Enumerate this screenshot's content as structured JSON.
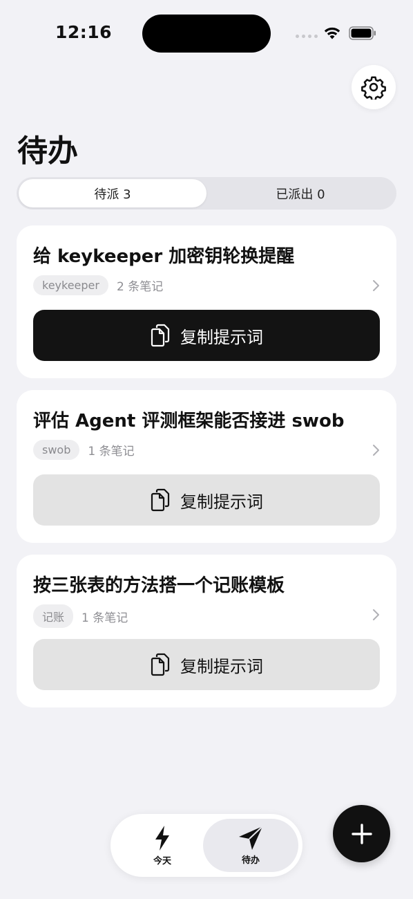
{
  "status_bar": {
    "time": "12:16"
  },
  "header": {
    "title": "待办"
  },
  "segments": [
    {
      "label": "待派 3",
      "active": true
    },
    {
      "label": "已派出 0",
      "active": false
    }
  ],
  "tasks": [
    {
      "title": "给 keykeeper 加密钥轮换提醒",
      "tag": "keykeeper",
      "notes": "2 条笔记",
      "button": "复制提示词",
      "button_style": "dark"
    },
    {
      "title": "评估 Agent 评测框架能否接进 swob",
      "tag": "swob",
      "notes": "1 条笔记",
      "button": "复制提示词",
      "button_style": "light"
    },
    {
      "title": "按三张表的方法搭一个记账模板",
      "tag": "记账",
      "notes": "1 条笔记",
      "button": "复制提示词",
      "button_style": "light"
    }
  ],
  "tabbar": {
    "items": [
      {
        "label": "今天",
        "icon": "bolt-icon",
        "active": false
      },
      {
        "label": "待办",
        "icon": "paper-plane-icon",
        "active": true
      }
    ]
  },
  "icons": {
    "settings": "gear-icon",
    "add": "plus-icon",
    "copy": "copy-icon",
    "chevron": "chevron-right-icon"
  },
  "colors": {
    "background": "#f2f2f6",
    "primary_button": "#131313",
    "secondary_button": "#e3e3e3"
  }
}
